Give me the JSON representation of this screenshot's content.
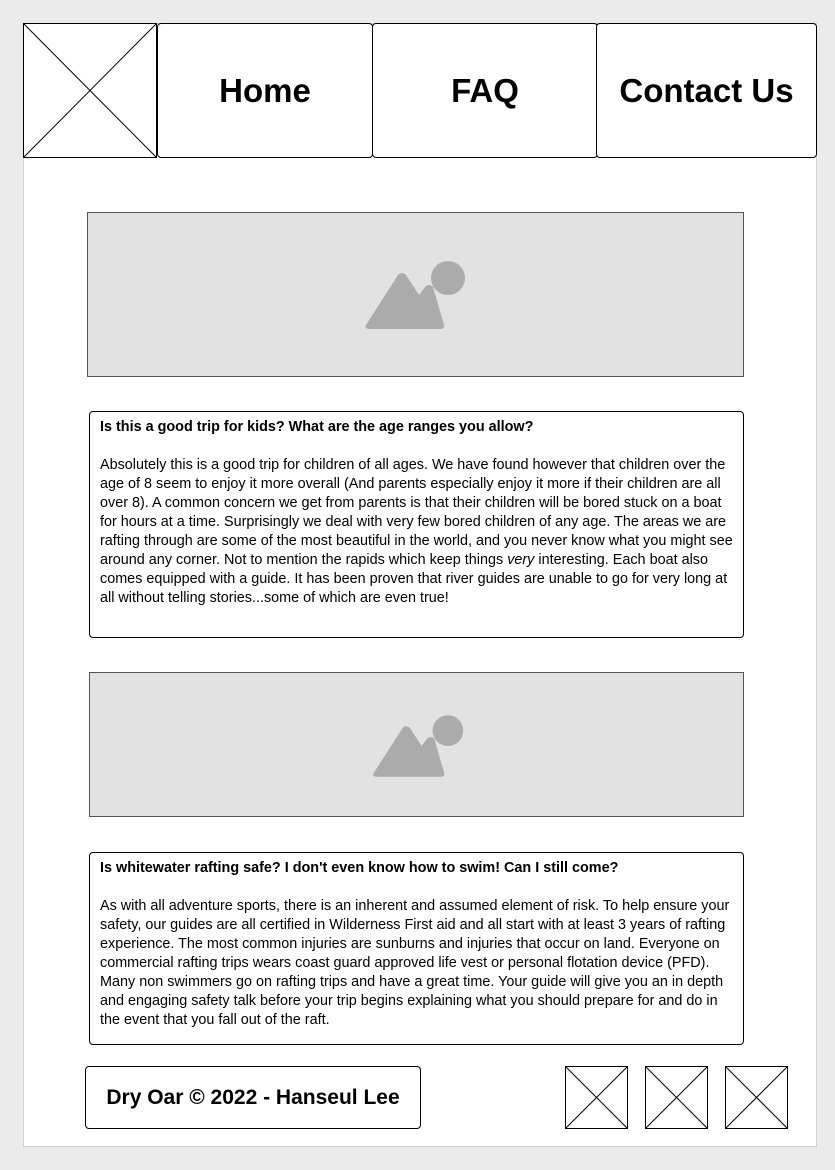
{
  "nav": {
    "logo_icon": "image-placeholder-x-icon",
    "items": [
      {
        "label": "Home"
      },
      {
        "label": "FAQ"
      },
      {
        "label": "Contact Us"
      }
    ]
  },
  "images": {
    "icon": "image-placeholder-mountain-icon",
    "fill_color": "#e2e2e2",
    "icon_color": "#ababab"
  },
  "faqs": [
    {
      "question": "Is this a good trip for kids? What are the age ranges you allow?",
      "answer_before": "Absolutely this is a good trip for children of all ages. We have found however that children over the age of 8 seem to enjoy it more overall (And parents especially enjoy it more if their children are all over 8). A common concern we get from parents is that their children will be bored stuck on a boat for hours at a time. Surprisingly we deal with very few bored children of any age. The areas we are rafting through are some of the most beautiful in the world, and you never know what you might see around any corner. Not to mention the rapids which keep things ",
      "answer_emphasis": "very",
      "answer_after": " interesting. Each boat also comes equipped with a guide. It has been proven that river guides are unable to go for very long at all without telling stories...some of which are even true!"
    },
    {
      "question": "Is whitewater rafting safe? I don't even know how to swim! Can I still come?",
      "answer": "As with all adventure sports, there is an inherent and assumed element of risk. To help ensure your safety, our guides are all certified in Wilderness First aid and all start with at least 3 years of rafting experience. The most common injuries are sunburns and injuries that occur on land. Everyone on commercial rafting trips wears coast guard approved life vest or personal flotation device (PFD). Many non swimmers go on rafting trips and have a great time. Your guide will give you an in depth and engaging safety talk before your trip begins explaining what you should prepare for and do in the event that you fall out of the raft."
    }
  ],
  "footer": {
    "copyright": "Dry Oar © 2022 - Hanseul Lee",
    "social_icons": [
      "social-placeholder-x-icon",
      "social-placeholder-x-icon",
      "social-placeholder-x-icon"
    ]
  }
}
